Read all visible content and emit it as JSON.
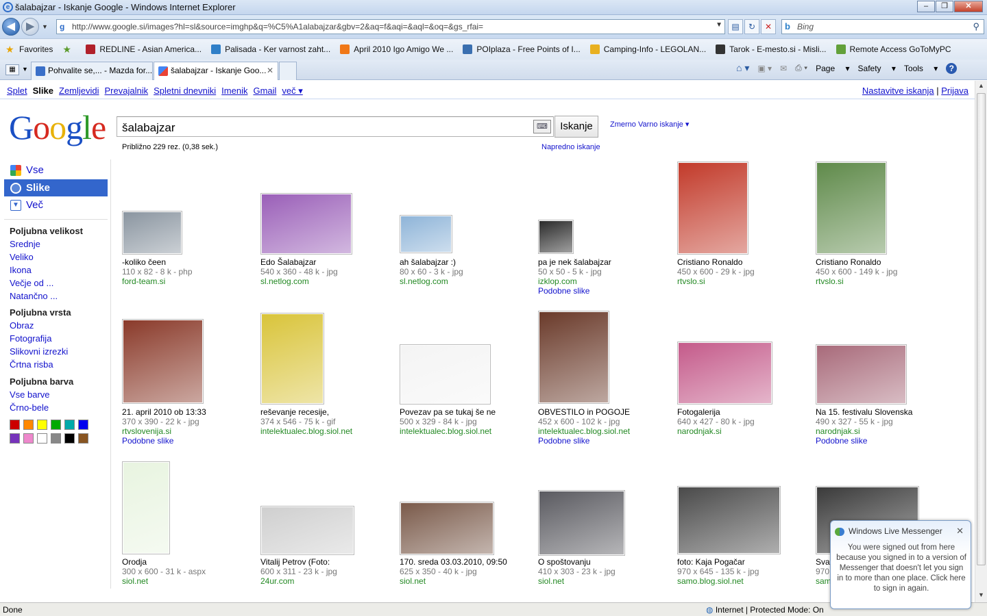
{
  "window": {
    "title": "šalabajzar - Iskanje Google - Windows Internet Explorer"
  },
  "nav": {
    "url": "http://www.google.si/images?hl=sl&source=imghp&q=%C5%A1alabajzar&gbv=2&aq=f&aqi=&aql=&oq=&gs_rfai=",
    "search_engine": "Bing"
  },
  "favorites": {
    "label": "Favorites",
    "items": [
      {
        "label": "REDLINE - Asian America...",
        "color": "#b0202a"
      },
      {
        "label": "Palisada - Ker varnost zaht...",
        "color": "#2f7fc8"
      },
      {
        "label": "April 2010  Igo Amigo We ...",
        "color": "#f07818"
      },
      {
        "label": "POIplaza - Free Points of I...",
        "color": "#3a6fb0"
      },
      {
        "label": "Camping-Info - LEGOLAN...",
        "color": "#e8b020"
      },
      {
        "label": "Tarok - E-mesto.si - Misli...",
        "color": "#333333"
      },
      {
        "label": "Remote Access  GoToMyPC",
        "color": "#62a03a"
      }
    ]
  },
  "tabs": [
    {
      "label": "Pohvalite se,... - Mazda for..."
    },
    {
      "label": "šalabajzar - Iskanje Goo..."
    }
  ],
  "toolbar": {
    "page": "Page",
    "safety": "Safety",
    "tools": "Tools",
    "help": "?"
  },
  "gbar": {
    "items": [
      "Splet",
      "Slike",
      "Zemljevidi",
      "Prevajalnik",
      "Spletni dnevniki",
      "Imenik",
      "Gmail",
      "več ▾"
    ],
    "settings": "Nastavitve iskanja",
    "signin": "Prijava"
  },
  "search": {
    "query": "šalabajzar",
    "button": "Iskanje",
    "safe": "Zmerno Varno iskanje ▾",
    "stats": "Približno 229 rez. (0,38 sek.)",
    "advanced": "Napredno iskanje"
  },
  "sidebar": {
    "modes": [
      {
        "label": "Vse",
        "color": "#34a853"
      },
      {
        "label": "Slike",
        "color": "#ffffff"
      },
      {
        "label": "Več",
        "color": "#3366cc"
      }
    ],
    "size_title": "Poljubna velikost",
    "sizes": [
      "Srednje",
      "Veliko",
      "Ikona",
      "Večje od ...",
      "Natančno ..."
    ],
    "type_title": "Poljubna vrsta",
    "types": [
      "Obraz",
      "Fotografija",
      "Slikovni izrezki",
      "Črtna risba"
    ],
    "color_title": "Poljubna barva",
    "colors_links": [
      "Vse barve",
      "Črno-bele"
    ],
    "swatches": [
      "#cc0000",
      "#ff8800",
      "#ffff00",
      "#00aa00",
      "#00aaaa",
      "#0000ee",
      "#7733bb",
      "#ee88cc",
      "#ffffff",
      "#888888",
      "#000000",
      "#885522"
    ]
  },
  "results": [
    {
      "title": "-koliko čeen",
      "meta": "110 x 82 - 8 k - php",
      "domain": "ford-team.si",
      "similar": "",
      "fill": "#8a95a0"
    },
    {
      "title": "Edo Šalabajzar",
      "meta": "540 x 360 - 48 k - jpg",
      "domain": "sl.netlog.com",
      "similar": "",
      "fill": "#9a5fb8"
    },
    {
      "title": "ah šalabajzar :)",
      "meta": "80 x 60 - 3 k - jpg",
      "domain": "sl.netlog.com",
      "similar": "",
      "fill": "#8eb4d8"
    },
    {
      "title": "pa je nek šalabajzar",
      "meta": "50 x 50 - 5 k - jpg",
      "domain": "izklop.com",
      "similar": "Podobne slike",
      "fill": "#2a2a2a"
    },
    {
      "title": "Cristiano Ronaldo",
      "meta": "450 x 600 - 29 k - jpg",
      "domain": "rtvslo.si",
      "similar": "",
      "fill": "#c23a2a"
    },
    {
      "title": "Cristiano Ronaldo",
      "meta": "450 x 600 - 149 k - jpg",
      "domain": "rtvslo.si",
      "similar": "",
      "fill": "#5f8a4a"
    },
    {
      "title": "21. april 2010 ob 13:33",
      "meta": "370 x 390 - 22 k - jpg",
      "domain": "rtvslovenija.si",
      "similar": "Podobne slike",
      "fill": "#8a3a2a"
    },
    {
      "title": "reševanje recesije,",
      "meta": "374 x 546 - 75 k - gif",
      "domain": "intelektualec.blog.siol.net",
      "similar": "",
      "fill": "#d9c43a"
    },
    {
      "title": "Povezav pa se tukaj še ne",
      "meta": "500 x 329 - 84 k - jpg",
      "domain": "intelektualec.blog.siol.net",
      "similar": "",
      "fill": "#f4f4f4"
    },
    {
      "title": "OBVESTILO in POGOJE",
      "meta": "452 x 600 - 102 k - jpg",
      "domain": "intelektualec.blog.siol.net",
      "similar": "Podobne slike",
      "fill": "#6a3a2a"
    },
    {
      "title": "Fotogalerija",
      "meta": "640 x 427 - 80 k - jpg",
      "domain": "narodnjak.si",
      "similar": "",
      "fill": "#c45a8a"
    },
    {
      "title": "Na 15. festivalu Slovenska",
      "meta": "490 x 327 - 55 k - jpg",
      "domain": "narodnjak.si",
      "similar": "Podobne slike",
      "fill": "#a86a7a"
    },
    {
      "title": "Orodja",
      "meta": "300 x 600 - 31 k - aspx",
      "domain": "siol.net",
      "similar": "",
      "fill": "#e8f4e0"
    },
    {
      "title": "Vitalij Petrov (Foto:",
      "meta": "600 x 311 - 23 k - jpg",
      "domain": "24ur.com",
      "similar": "",
      "fill": "#cfcfcf"
    },
    {
      "title": "170. sreda 03.03.2010, 09:50",
      "meta": "625 x 350 - 40 k - jpg",
      "domain": "siol.net",
      "similar": "",
      "fill": "#7a5a4a"
    },
    {
      "title": "O spoštovanju",
      "meta": "410 x 303 - 23 k - jpg",
      "domain": "siol.net",
      "similar": "",
      "fill": "#5a5a60"
    },
    {
      "title": "foto: Kaja Pogačar",
      "meta": "970 x 645 - 135 k - jpg",
      "domain": "samo.blog.siol.net",
      "similar": "",
      "fill": "#4a4a4a"
    },
    {
      "title": "Svat",
      "meta": "970",
      "domain": "sam",
      "similar": "",
      "fill": "#3a3a3a"
    }
  ],
  "status": {
    "left": "Done",
    "zone": "Internet | Protected Mode: On"
  },
  "messenger": {
    "title": "Windows Live Messenger",
    "body": "You were signed out from here because you signed in to a version of Messenger that doesn't let you sign in to more than one place. Click here to sign in again."
  }
}
